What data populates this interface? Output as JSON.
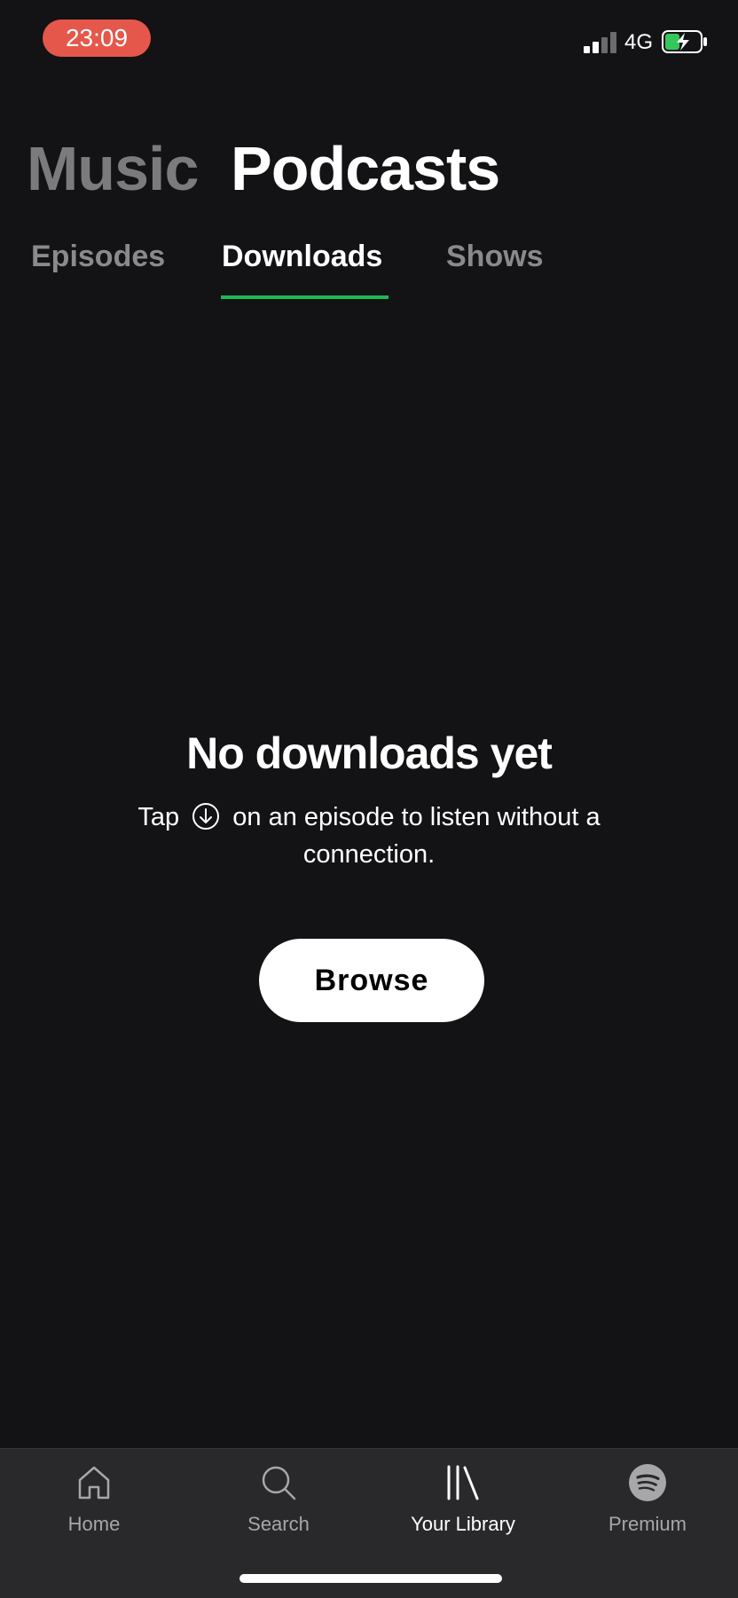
{
  "status_bar": {
    "time": "23:09",
    "network": "4G",
    "colors": {
      "time_pill": "#e5574a",
      "battery_fill": "#34c759"
    },
    "icons": [
      "signal-icon",
      "battery-charging-icon"
    ]
  },
  "top_tabs": [
    {
      "label": "Music",
      "active": false
    },
    {
      "label": "Podcasts",
      "active": true
    }
  ],
  "sub_tabs": [
    {
      "label": "Episodes",
      "active": false
    },
    {
      "label": "Downloads",
      "active": true
    },
    {
      "label": "Shows",
      "active": false
    }
  ],
  "accent_color": "#1db954",
  "empty_state": {
    "title": "No downloads yet",
    "desc_before": "Tap",
    "desc_icon": "download-circle-icon",
    "desc_after": "on an episode to listen without a connection.",
    "button_label": "Browse"
  },
  "bottom_nav": [
    {
      "label": "Home",
      "icon": "home-icon",
      "active": false
    },
    {
      "label": "Search",
      "icon": "search-icon",
      "active": false
    },
    {
      "label": "Your Library",
      "icon": "library-icon",
      "active": true
    },
    {
      "label": "Premium",
      "icon": "spotify-logo-icon",
      "active": false
    }
  ]
}
